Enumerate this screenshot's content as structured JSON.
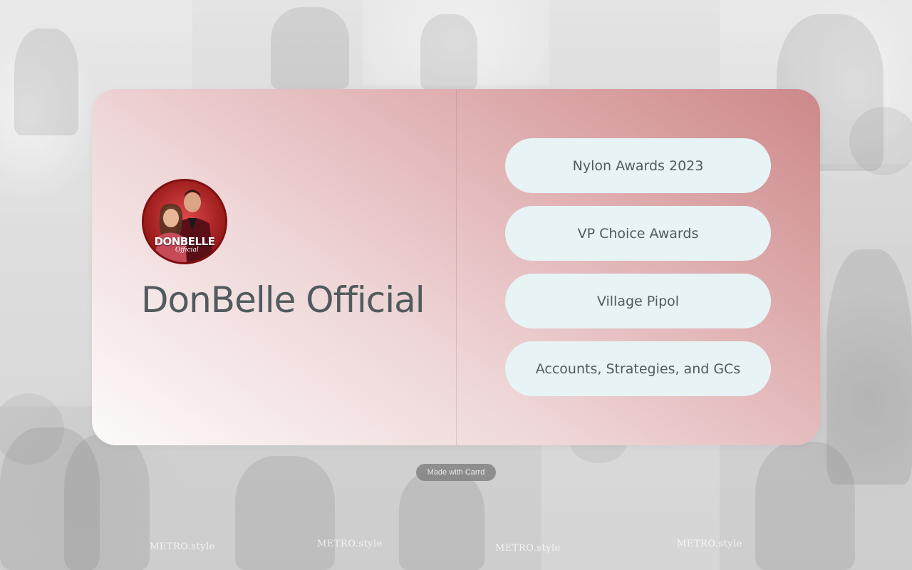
{
  "profile": {
    "name": "DonBelle Official",
    "avatar_logo_text": "DONBELLE",
    "avatar_logo_subtext": "Official"
  },
  "links": [
    {
      "label": "Nylon Awards 2023"
    },
    {
      "label": "VP Choice Awards"
    },
    {
      "label": "Village Pipol"
    },
    {
      "label": "Accounts, Strategies, and GCs"
    }
  ],
  "footer": {
    "made_with": "Made with Carrd"
  },
  "background": {
    "watermarks": [
      "METRO.style",
      "METRO.style",
      "METRO.style",
      "METRO.style"
    ]
  },
  "colors": {
    "card_gradient_start": "#cd8889",
    "card_gradient_end": "#fdfafa",
    "button_bg": "#e7f3f5",
    "text": "#515b5e",
    "avatar_ring": "#7f1010"
  }
}
